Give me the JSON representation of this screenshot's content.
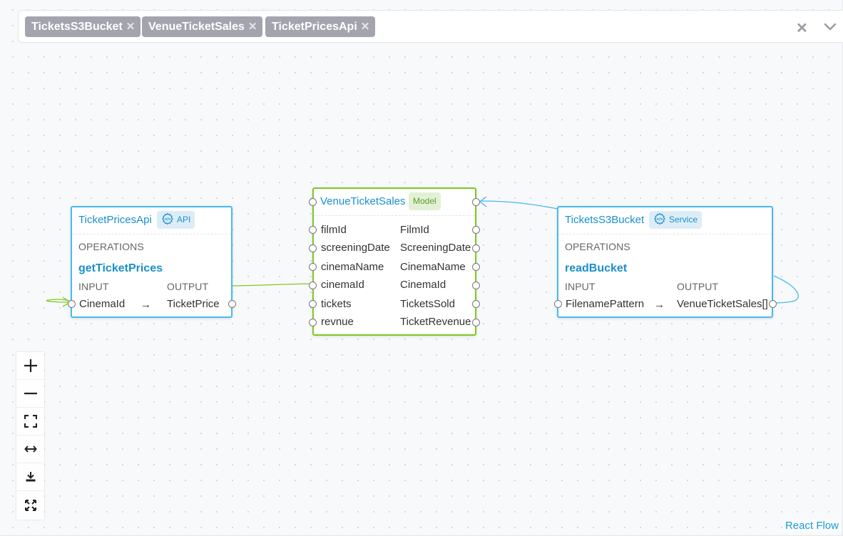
{
  "filter_bar": {
    "chips": [
      {
        "label": "TicketsS3Bucket",
        "remove": "✕"
      },
      {
        "label": "VenueTicketSales",
        "remove": "✕"
      },
      {
        "label": "TicketPricesApi",
        "remove": "✕"
      }
    ],
    "clear_icon": "✕"
  },
  "nodes": {
    "ticket_prices_api": {
      "title": "TicketPricesApi",
      "badge": "API",
      "section": "OPERATIONS",
      "operation": "getTicketPrices",
      "input_label": "INPUT",
      "output_label": "OUTPUT",
      "input": "CinemaId",
      "arrow": "→",
      "output": "TicketPrice"
    },
    "venue_ticket_sales": {
      "title": "VenueTicketSales",
      "badge": "Model",
      "fields": [
        {
          "name": "filmId",
          "type": "FilmId"
        },
        {
          "name": "screeningDate",
          "type": "ScreeningDate"
        },
        {
          "name": "cinemaName",
          "type": "CinemaName"
        },
        {
          "name": "cinemaId",
          "type": "CinemaId"
        },
        {
          "name": "tickets",
          "type": "TicketsSold"
        },
        {
          "name": "revnue",
          "type": "TicketRevenue"
        }
      ]
    },
    "tickets_s3_bucket": {
      "title": "TicketsS3Bucket",
      "badge": "Service",
      "section": "OPERATIONS",
      "operation": "readBucket",
      "input_label": "INPUT",
      "output_label": "OUTPUT",
      "input": "FilenamePattern",
      "arrow": "→",
      "output": "VenueTicketSales[]"
    }
  },
  "colors": {
    "service_border": "#47baf0",
    "model_border": "#7ec91f",
    "accent_text": "#1b8fcc",
    "chip_bg": "#a3a4ad"
  },
  "controls": {
    "items": [
      "zoom-in",
      "zoom-out",
      "fit-view",
      "horizontal-layout",
      "download",
      "fullscreen"
    ]
  },
  "attribution": "React Flow"
}
